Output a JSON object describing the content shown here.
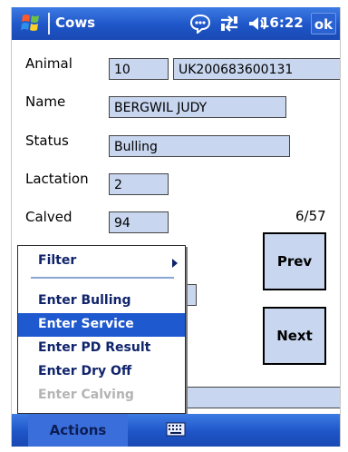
{
  "titlebar": {
    "app_title": "Cows",
    "time": "16:22",
    "ok_label": "ok",
    "icons": [
      "windows-start-icon",
      "notification-bubble-icon",
      "connectivity-icon",
      "volume-icon"
    ]
  },
  "form": {
    "animal_label": "Animal",
    "animal_number": "10",
    "animal_tag": "UK200683600131",
    "name_label": "Name",
    "name_value": "BERGWIL JUDY",
    "status_label": "Status",
    "status_value": "Bulling",
    "lactation_label": "Lactation",
    "lactation_value": "2",
    "calved_label": "Calved",
    "calved_value": "94",
    "record_counter": "6/57"
  },
  "buttons": {
    "prev_label": "Prev",
    "next_label": "Next"
  },
  "menu": {
    "filter_label": "Filter",
    "items": [
      {
        "label": "Enter Bulling",
        "state": "normal"
      },
      {
        "label": "Enter Service",
        "state": "selected"
      },
      {
        "label": "Enter PD Result",
        "state": "normal"
      },
      {
        "label": "Enter Dry Off",
        "state": "normal"
      },
      {
        "label": "Enter Calving",
        "state": "disabled"
      }
    ]
  },
  "bottombar": {
    "actions_label": "Actions",
    "keyboard_icon": "keyboard-icon"
  },
  "colors": {
    "titlebar_blue": "#1e55c8",
    "field_fill": "#c8d6ef",
    "menu_highlight": "#1f59cf",
    "menu_text": "#10246b",
    "disabled_text": "#b4b4b4"
  }
}
